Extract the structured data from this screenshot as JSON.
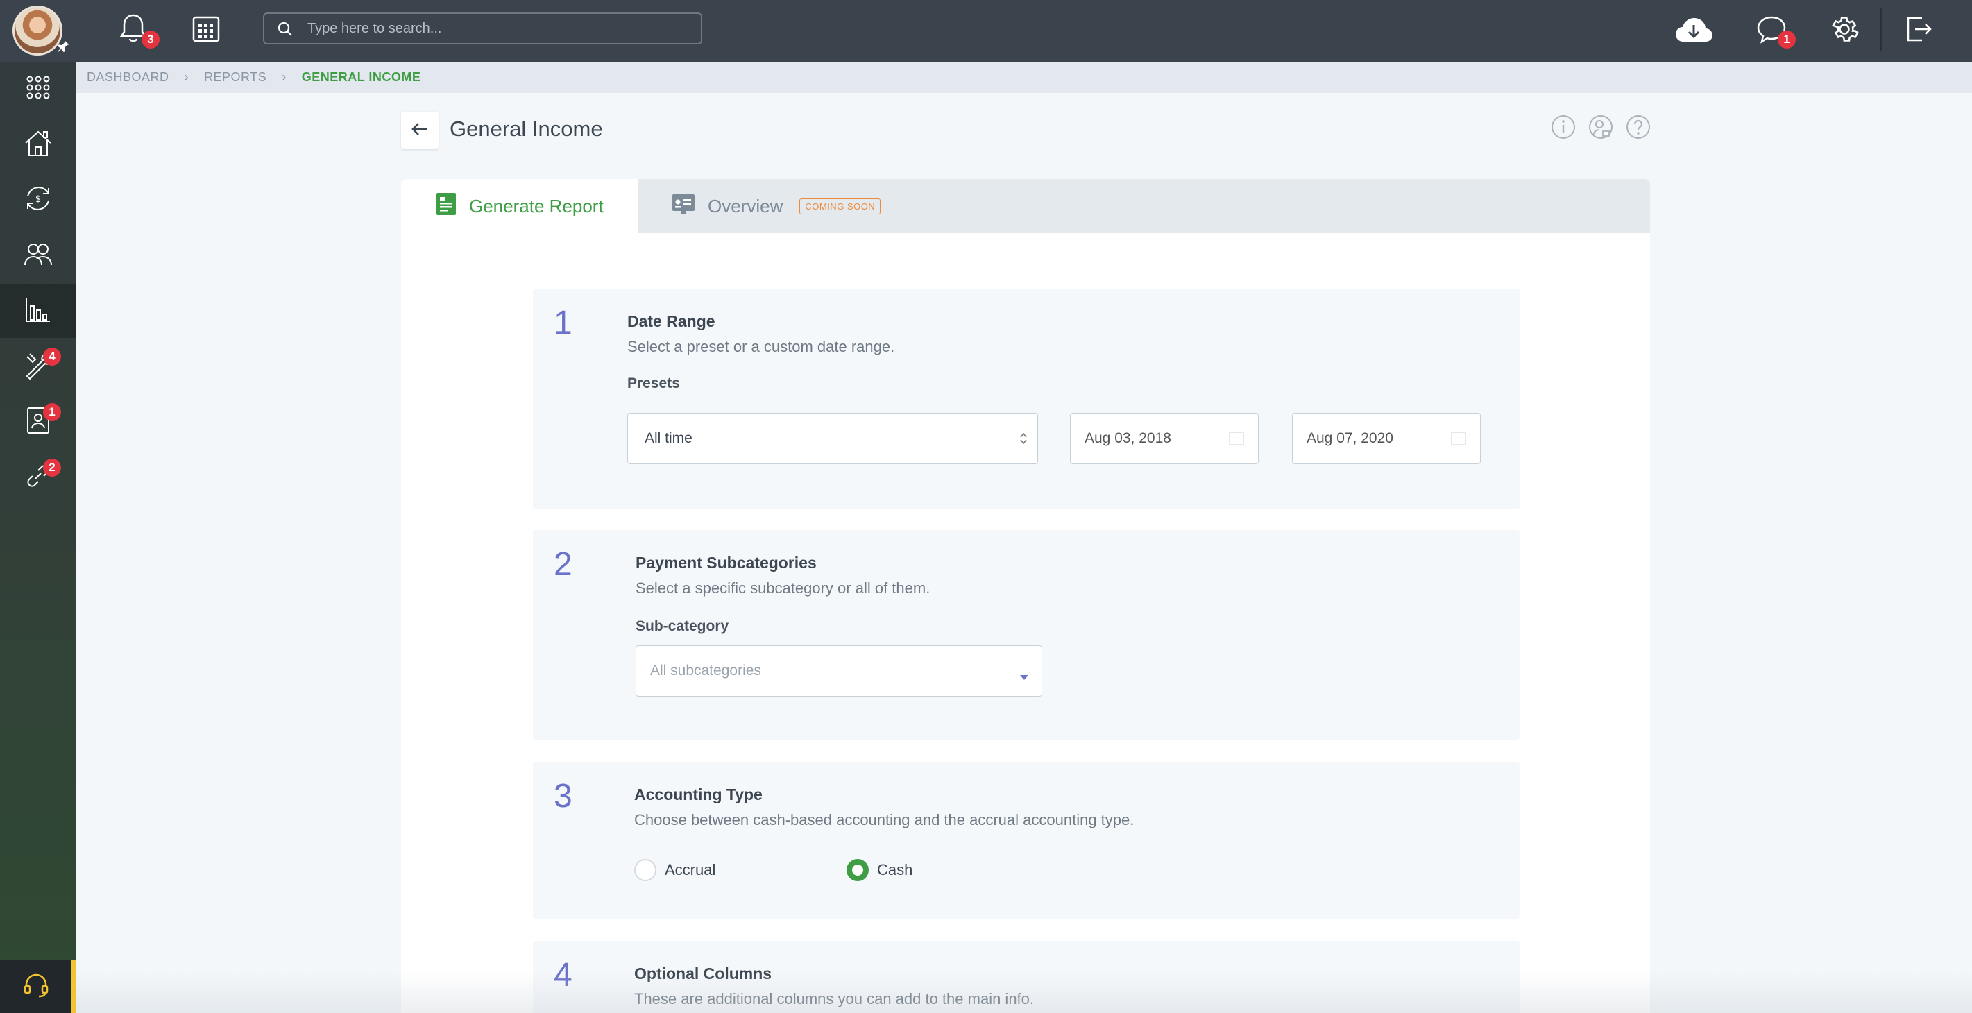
{
  "topbar": {
    "notifications_count": "3",
    "search_placeholder": "Type here to search...",
    "messages_count": "1"
  },
  "sidebar": {
    "items": [
      {
        "name": "apps",
        "icon": "grid-icon"
      },
      {
        "name": "properties",
        "icon": "house-icon"
      },
      {
        "name": "payments",
        "icon": "exchange-icon"
      },
      {
        "name": "people",
        "icon": "people-icon"
      },
      {
        "name": "reports",
        "icon": "chart-icon",
        "active": true
      },
      {
        "name": "maintenance",
        "icon": "tools-icon",
        "badge": "4"
      },
      {
        "name": "contacts",
        "icon": "contact-icon",
        "badge": "1"
      },
      {
        "name": "integrations",
        "icon": "link-icon",
        "badge": "2"
      }
    ]
  },
  "breadcrumb": {
    "items": [
      "DASHBOARD",
      "REPORTS"
    ],
    "current": "GENERAL INCOME"
  },
  "page": {
    "title": "General Income"
  },
  "tabs": {
    "generate": "Generate Report",
    "overview": "Overview",
    "coming_soon": "COMING SOON"
  },
  "steps": {
    "one": {
      "num": "1",
      "title": "Date Range",
      "desc": "Select a preset or a custom date range.",
      "label": "Presets",
      "preset_value": "All time",
      "date_from": "Aug 03, 2018",
      "date_to": "Aug 07, 2020"
    },
    "two": {
      "num": "2",
      "title": "Payment Subcategories",
      "desc": "Select a specific subcategory or all of them.",
      "label": "Sub-category",
      "placeholder": "All subcategories"
    },
    "three": {
      "num": "3",
      "title": "Accounting Type",
      "desc": "Choose between cash-based accounting and the accrual accounting type.",
      "option_accrual": "Accrual",
      "option_cash": "Cash"
    },
    "four": {
      "num": "4",
      "title": "Optional Columns",
      "desc": "These are additional columns you can add to the main info."
    }
  },
  "colors": {
    "accent_green": "#3f9e45",
    "step_number": "#6a72c9",
    "badge_red": "#e3343f",
    "topbar": "#3b444c"
  }
}
